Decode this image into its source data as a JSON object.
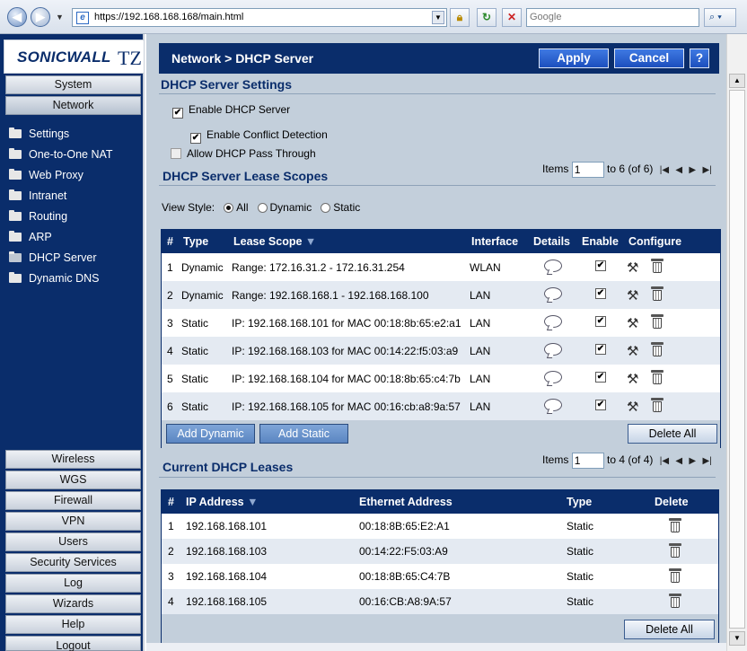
{
  "browser": {
    "back_glyph": "◀",
    "forward_glyph": "▶",
    "url": "https://192.168.168.168/main.html",
    "search_placeholder": "Google",
    "icons": [
      "back-icon",
      "forward-icon",
      "lock-icon",
      "refresh-icon",
      "stop-icon",
      "search-icon"
    ]
  },
  "logo": {
    "brand": "SONICWALL",
    "model": "TZ"
  },
  "leftnav": {
    "top_items": [
      {
        "label": "System"
      },
      {
        "label": "Network"
      }
    ],
    "sub_items": [
      {
        "label": "Settings"
      },
      {
        "label": "One-to-One NAT"
      },
      {
        "label": "Web Proxy"
      },
      {
        "label": "Intranet"
      },
      {
        "label": "Routing"
      },
      {
        "label": "ARP"
      },
      {
        "label": "DHCP Server"
      },
      {
        "label": "Dynamic DNS"
      }
    ],
    "bottom_items": [
      {
        "label": "Wireless"
      },
      {
        "label": "WGS"
      },
      {
        "label": "Firewall"
      },
      {
        "label": "VPN"
      },
      {
        "label": "Users"
      },
      {
        "label": "Security Services"
      },
      {
        "label": "Log"
      },
      {
        "label": "Wizards"
      },
      {
        "label": "Help"
      },
      {
        "label": "Logout"
      }
    ]
  },
  "header": {
    "title": "Network > DHCP Server",
    "apply_label": "Apply",
    "cancel_label": "Cancel",
    "help_label": "?"
  },
  "settings": {
    "title": "DHCP Server Settings",
    "enable_dhcp": {
      "label": "Enable DHCP Server",
      "checked": true
    },
    "enable_conflict": {
      "label": "Enable Conflict Detection",
      "checked": true
    },
    "allow_passthrough": {
      "label": "Allow DHCP Pass Through",
      "checked": false
    }
  },
  "scopes": {
    "title": "DHCP Server Lease Scopes",
    "pager": {
      "label": "Items",
      "value": "1",
      "range": "to 6 (of 6)"
    },
    "view_style": {
      "label": "View Style:",
      "options": [
        "All",
        "Dynamic",
        "Static"
      ],
      "selected": "All"
    },
    "columns": [
      "#",
      "Type",
      "Lease Scope",
      "Interface",
      "Details",
      "Enable",
      "Configure"
    ],
    "rows": [
      {
        "num": "1",
        "type": "Dynamic",
        "scope": "Range: 172.16.31.2 - 172.16.31.254",
        "iface": "WLAN"
      },
      {
        "num": "2",
        "type": "Dynamic",
        "scope": "Range: 192.168.168.1 - 192.168.168.100",
        "iface": "LAN"
      },
      {
        "num": "3",
        "type": "Static",
        "scope": "IP: 192.168.168.101 for MAC 00:18:8b:65:e2:a1",
        "iface": "LAN"
      },
      {
        "num": "4",
        "type": "Static",
        "scope": "IP: 192.168.168.103 for MAC 00:14:22:f5:03:a9",
        "iface": "LAN"
      },
      {
        "num": "5",
        "type": "Static",
        "scope": "IP: 192.168.168.104 for MAC 00:18:8b:65:c4:7b",
        "iface": "LAN"
      },
      {
        "num": "6",
        "type": "Static",
        "scope": "IP: 192.168.168.105 for MAC 00:16:cb:a8:9a:57",
        "iface": "LAN"
      }
    ],
    "add_dynamic_label": "Add Dynamic",
    "add_static_label": "Add Static",
    "delete_all_label": "Delete All"
  },
  "leases": {
    "title": "Current DHCP Leases",
    "pager": {
      "label": "Items",
      "value": "1",
      "range": "to 4 (of 4)"
    },
    "columns": [
      "#",
      "IP Address",
      "Ethernet Address",
      "Type",
      "Delete"
    ],
    "rows": [
      {
        "num": "1",
        "ip": "192.168.168.101",
        "mac": "00:18:8B:65:E2:A1",
        "type": "Static"
      },
      {
        "num": "2",
        "ip": "192.168.168.103",
        "mac": "00:14:22:F5:03:A9",
        "type": "Static"
      },
      {
        "num": "3",
        "ip": "192.168.168.104",
        "mac": "00:18:8B:65:C4:7B",
        "type": "Static"
      },
      {
        "num": "4",
        "ip": "192.168.168.105",
        "mac": "00:16:CB:A8:9A:57",
        "type": "Static"
      }
    ],
    "delete_all_label": "Delete All"
  },
  "colors": {
    "nav_blue": "#0a2d6b",
    "content_bg": "#c3cfdb",
    "button_blue": "#2d62cf"
  }
}
